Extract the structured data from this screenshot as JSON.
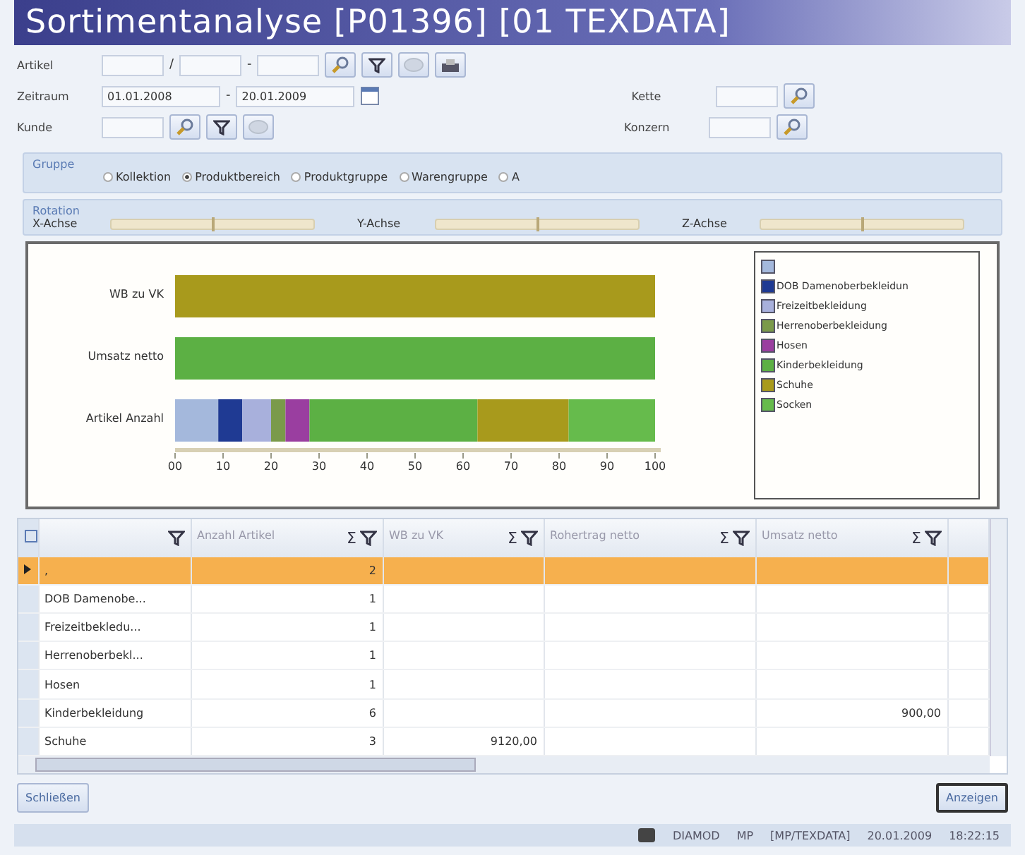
{
  "window": {
    "title": "Sortimentanalyse [P01396] [01 TEXDATA]"
  },
  "filters": {
    "artikel": {
      "label": "Artikel",
      "sep1": "/",
      "sep2": "-"
    },
    "zeitraum": {
      "label": "Zeitraum",
      "from": "01.01.2008",
      "sep": "-",
      "to": "20.01.2009"
    },
    "kunde": {
      "label": "Kunde"
    },
    "kette": {
      "label": "Kette"
    },
    "konzern": {
      "label": "Konzern"
    }
  },
  "gruppe": {
    "title": "Gruppe",
    "options": [
      {
        "label": "Kollektion",
        "selected": false
      },
      {
        "label": "Produktbereich",
        "selected": true
      },
      {
        "label": "Produktgruppe",
        "selected": false
      },
      {
        "label": "Warengruppe",
        "selected": false
      },
      {
        "label": "A",
        "selected": false
      }
    ]
  },
  "rotation": {
    "title": "Rotation",
    "axes": [
      {
        "label": "X-Achse",
        "level": 0.5
      },
      {
        "label": "Y-Achse",
        "level": 0.5
      },
      {
        "label": "Z-Achse",
        "level": 0.5
      }
    ]
  },
  "chart": {
    "chart_data": {
      "type": "bar",
      "orientation": "horizontal",
      "stacked": true,
      "categories": [
        "WB zu VK",
        "Umsatz netto",
        "Artikel Anzahl"
      ],
      "xlim": [
        0,
        100
      ],
      "xticks": [
        {
          "value": 0,
          "label": "00"
        },
        10,
        20,
        30,
        40,
        50,
        60,
        70,
        80,
        90,
        100
      ],
      "series": [
        {
          "color": "#a4b8dc",
          "values": [
            0,
            0,
            9
          ]
        },
        {
          "name": "DOB Damenoberbekleidun",
          "color": "#1f3a93",
          "values": [
            0,
            0,
            5
          ]
        },
        {
          "name": "Freizeitbekleidung",
          "color": "#a8b0dc",
          "values": [
            0,
            0,
            6
          ]
        },
        {
          "name": "Herrenoberbekleidung",
          "color": "#7a9a4a",
          "values": [
            0,
            0,
            3
          ]
        },
        {
          "name": "Hosen",
          "color": "#9a3ea0",
          "values": [
            0,
            0,
            5
          ]
        },
        {
          "name": "Kinderbekleidung",
          "color": "#5cb044",
          "values": [
            0,
            100,
            35
          ]
        },
        {
          "name": "Schuhe",
          "color": "#a89a1c",
          "values": [
            100,
            0,
            19
          ]
        },
        {
          "name": "Socken",
          "color": "#66bb4c",
          "values": [
            0,
            0,
            18
          ]
        }
      ]
    }
  },
  "table": {
    "columns": [
      {
        "label": "Anzahl Artikel",
        "sum": "Σ"
      },
      {
        "label": "WB zu VK",
        "sum": "Σ"
      },
      {
        "label": "Rohertrag netto",
        "sum": "Σ"
      },
      {
        "label": "Umsatz netto",
        "sum": "Σ"
      }
    ],
    "rows": [
      {
        "label": ",",
        "anzahl": "2",
        "selected": true
      },
      {
        "label": "DOB Damenobe...",
        "anzahl": "1",
        "selected": false
      },
      {
        "label": "Freizeitbekledu...",
        "anzahl": "1",
        "selected": false
      },
      {
        "label": "Herrenoberbekl...",
        "anzahl": "1",
        "selected": false
      },
      {
        "label": "Hosen",
        "anzahl": "1",
        "selected": false
      },
      {
        "label": "Kinderbekleidung",
        "anzahl": "6",
        "umsatz": "900,00",
        "selected": false
      },
      {
        "label": "Schuhe",
        "anzahl": "3",
        "wb": "9120,00",
        "selected": false
      }
    ]
  },
  "buttons": {
    "close": "Schließen",
    "show": "Anzeigen"
  },
  "status_bar": {
    "app": "DIAMOD",
    "user": "MP",
    "company": "[MP/TEXDATA]",
    "date": "20.01.2009",
    "time": "18:22:15"
  }
}
